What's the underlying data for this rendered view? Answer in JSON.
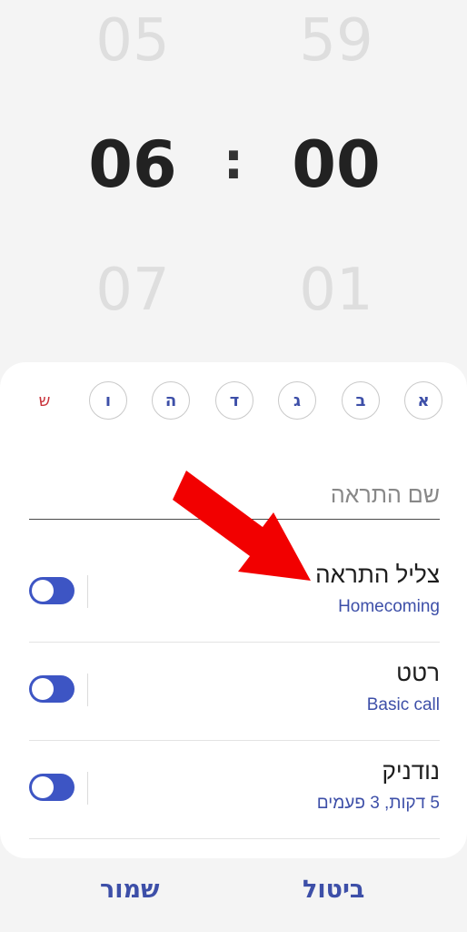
{
  "time_picker": {
    "hour_prev": "05",
    "hour": "06",
    "hour_next": "07",
    "separator": ":",
    "minute_prev": "59",
    "minute": "00",
    "minute_next": "01"
  },
  "days": [
    "א",
    "ב",
    "ג",
    "ד",
    "ה",
    "ו",
    "ש"
  ],
  "alarm_name": {
    "placeholder": "שם התראה"
  },
  "settings": [
    {
      "title": "צליל התראה",
      "subtitle": "Homecoming",
      "enabled": true
    },
    {
      "title": "רטט",
      "subtitle": "Basic call",
      "enabled": true
    },
    {
      "title": "נודניק",
      "subtitle": "5 דקות, 3 פעמים",
      "enabled": true
    }
  ],
  "footer": {
    "cancel_label": "ביטול",
    "save_label": "שמור"
  },
  "colors": {
    "accent": "#3d4fa8",
    "toggle_on": "#3d55c4",
    "sunday_text": "#c8323a",
    "annotation_arrow": "#f20000"
  }
}
